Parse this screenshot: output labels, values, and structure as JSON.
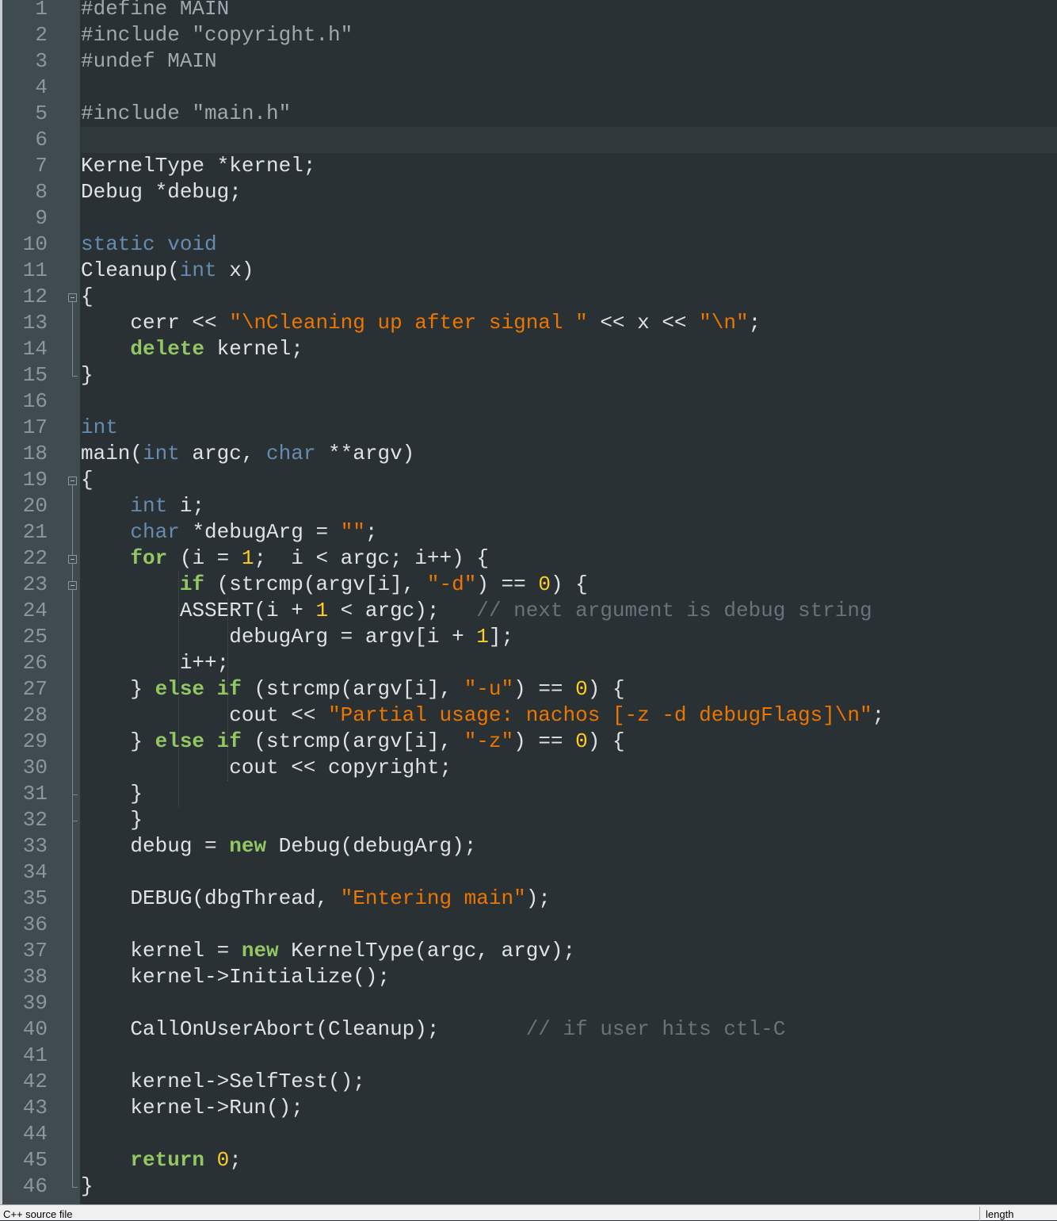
{
  "line_numbers": [
    "1",
    "2",
    "3",
    "4",
    "5",
    "6",
    "7",
    "8",
    "9",
    "10",
    "11",
    "12",
    "13",
    "14",
    "15",
    "16",
    "17",
    "18",
    "19",
    "20",
    "21",
    "22",
    "23",
    "24",
    "25",
    "26",
    "27",
    "28",
    "29",
    "30",
    "31",
    "32",
    "33",
    "34",
    "35",
    "36",
    "37",
    "38",
    "39",
    "40",
    "41",
    "42",
    "43",
    "44",
    "45",
    "46"
  ],
  "current_line": "6",
  "code_lines": [
    [
      [
        "pp",
        "#define MAIN"
      ]
    ],
    [
      [
        "pp",
        "#include \"copyright.h\""
      ]
    ],
    [
      [
        "pp",
        "#undef MAIN"
      ]
    ],
    [],
    [
      [
        "pp",
        "#include \"main.h\""
      ]
    ],
    [],
    [
      [
        "",
        "KernelType *kernel;"
      ]
    ],
    [
      [
        "",
        "Debug *debug;"
      ]
    ],
    [],
    [
      [
        "ty",
        "static void"
      ]
    ],
    [
      [
        "",
        "Cleanup("
      ],
      [
        "ty",
        "int"
      ],
      [
        "",
        " x)"
      ]
    ],
    [
      [
        "",
        "{"
      ]
    ],
    [
      [
        "",
        "    cerr << "
      ],
      [
        "st",
        "\"\\nCleaning up after signal \""
      ],
      [
        "",
        " << x << "
      ],
      [
        "st",
        "\"\\n\""
      ],
      [
        "",
        ";"
      ]
    ],
    [
      [
        "",
        "    "
      ],
      [
        "kw",
        "delete"
      ],
      [
        "",
        " kernel;"
      ]
    ],
    [
      [
        "",
        "}"
      ]
    ],
    [],
    [
      [
        "ty",
        "int"
      ]
    ],
    [
      [
        "",
        "main("
      ],
      [
        "ty",
        "int"
      ],
      [
        "",
        " argc, "
      ],
      [
        "ty",
        "char"
      ],
      [
        "",
        " **argv)"
      ]
    ],
    [
      [
        "",
        "{"
      ]
    ],
    [
      [
        "",
        "    "
      ],
      [
        "ty",
        "int"
      ],
      [
        "",
        " i;"
      ]
    ],
    [
      [
        "",
        "    "
      ],
      [
        "ty",
        "char"
      ],
      [
        "",
        " *debugArg = "
      ],
      [
        "st",
        "\"\""
      ],
      [
        "",
        ";"
      ]
    ],
    [
      [
        "",
        "    "
      ],
      [
        "kw",
        "for"
      ],
      [
        "",
        " (i = "
      ],
      [
        "nu",
        "1"
      ],
      [
        "",
        ";  i < argc; i++) {"
      ]
    ],
    [
      [
        "",
        "        "
      ],
      [
        "kw",
        "if"
      ],
      [
        "",
        " (strcmp(argv[i], "
      ],
      [
        "st",
        "\"-d\""
      ],
      [
        "",
        ") == "
      ],
      [
        "nu",
        "0"
      ],
      [
        "",
        ") {"
      ]
    ],
    [
      [
        "",
        "        ASSERT(i + "
      ],
      [
        "nu",
        "1"
      ],
      [
        "",
        " < argc);   "
      ],
      [
        "cm",
        "// next argument is debug string"
      ]
    ],
    [
      [
        "",
        "            debugArg = argv[i + "
      ],
      [
        "nu",
        "1"
      ],
      [
        "",
        "];"
      ]
    ],
    [
      [
        "",
        "        i++;"
      ]
    ],
    [
      [
        "",
        "    } "
      ],
      [
        "kw",
        "else if"
      ],
      [
        "",
        " (strcmp(argv[i], "
      ],
      [
        "st",
        "\"-u\""
      ],
      [
        "",
        ") == "
      ],
      [
        "nu",
        "0"
      ],
      [
        "",
        ") {"
      ]
    ],
    [
      [
        "",
        "            cout << "
      ],
      [
        "st",
        "\"Partial usage: nachos [-z -d debugFlags]\\n\""
      ],
      [
        "",
        ";"
      ]
    ],
    [
      [
        "",
        "    } "
      ],
      [
        "kw",
        "else if"
      ],
      [
        "",
        " (strcmp(argv[i], "
      ],
      [
        "st",
        "\"-z\""
      ],
      [
        "",
        ") == "
      ],
      [
        "nu",
        "0"
      ],
      [
        "",
        ") {"
      ]
    ],
    [
      [
        "",
        "            cout << copyright;"
      ]
    ],
    [
      [
        "",
        "    }"
      ]
    ],
    [
      [
        "",
        "    }"
      ]
    ],
    [
      [
        "",
        "    debug = "
      ],
      [
        "kw",
        "new"
      ],
      [
        "",
        " Debug(debugArg);"
      ]
    ],
    [],
    [
      [
        "",
        "    DEBUG(dbgThread, "
      ],
      [
        "st",
        "\"Entering main\""
      ],
      [
        "",
        ");"
      ]
    ],
    [],
    [
      [
        "",
        "    kernel = "
      ],
      [
        "kw",
        "new"
      ],
      [
        "",
        " KernelType(argc, argv);"
      ]
    ],
    [
      [
        "",
        "    kernel->Initialize();"
      ]
    ],
    [],
    [
      [
        "",
        "    CallOnUserAbort(Cleanup);       "
      ],
      [
        "cm",
        "// if user hits ctl-C"
      ]
    ],
    [],
    [
      [
        "",
        "    kernel->SelfTest();"
      ]
    ],
    [
      [
        "",
        "    kernel->Run();"
      ]
    ],
    [],
    [
      [
        "",
        "    "
      ],
      [
        "kw",
        "return"
      ],
      [
        "",
        " "
      ],
      [
        "nu",
        "0"
      ],
      [
        "",
        ";"
      ]
    ],
    [
      [
        "",
        "}"
      ]
    ]
  ],
  "folds": [
    {
      "start_line": "12",
      "end_line": "15"
    },
    {
      "start_line": "19",
      "end_line": "46"
    },
    {
      "start_line": "22",
      "end_line": "32"
    },
    {
      "start_line": "23",
      "end_line": "31"
    }
  ],
  "status": {
    "left": "C++ source file",
    "right": "length"
  },
  "colors": {
    "background": "#293134",
    "gutter": "#3f4b4e",
    "keyword": "#93c763",
    "type": "#678cb1",
    "string": "#ec7600",
    "number": "#ffcd22",
    "comment": "#66747b",
    "preprocessor": "#a0a8b0",
    "text": "#e0e2e4"
  }
}
